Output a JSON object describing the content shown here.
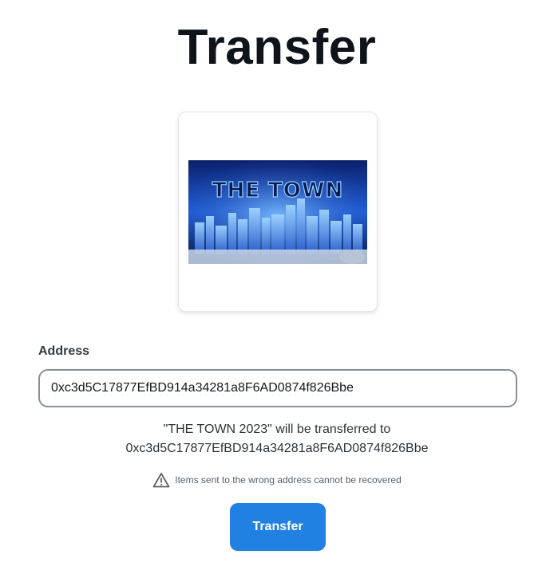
{
  "page": {
    "title": "Transfer"
  },
  "nft": {
    "image_text": "THE TOWN",
    "name": "THE TOWN 2023"
  },
  "form": {
    "address_label": "Address",
    "address_value": "0xc3d5C17877EfBD914a34281a8F6AD0874f826Bbe",
    "summary_line1": "\"THE TOWN 2023\" will be transferred to",
    "summary_line2": "0xc3d5C17877EfBD914a34281a8F6AD0874f826Bbe",
    "warning_icon": "warning-triangle-icon",
    "warning_text": "Items sent to the wrong address cannot be recovered",
    "submit_label": "Transfer"
  },
  "colors": {
    "primary_button": "#2081e2",
    "title": "#0f141a"
  }
}
